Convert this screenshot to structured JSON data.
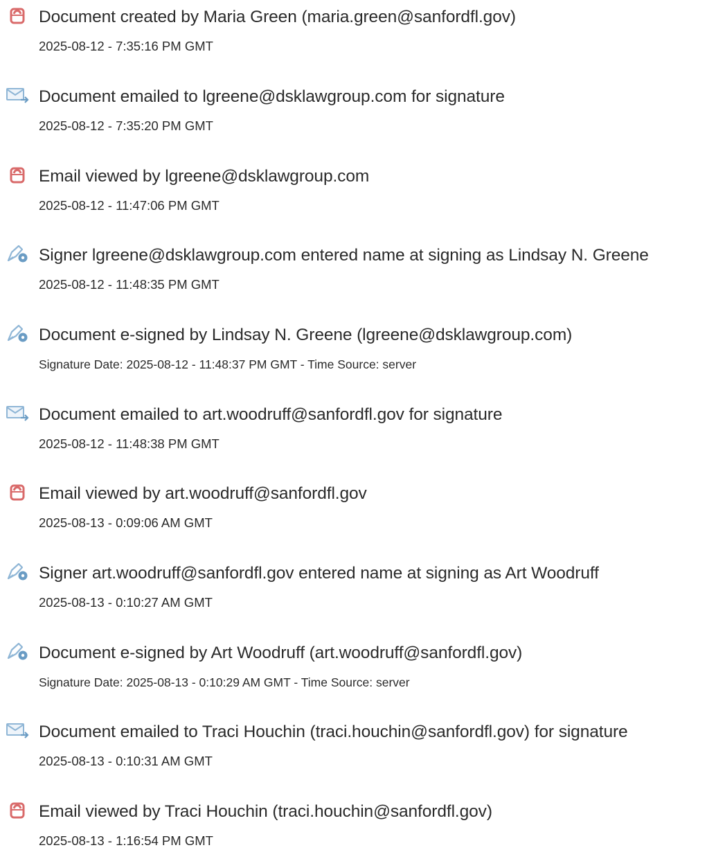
{
  "colors": {
    "pdf_icon": "#d96a6a",
    "email_icon": "#8fb6d6",
    "sign_icon": "#6a9cc4",
    "text": "#2a2a2a"
  },
  "events": [
    {
      "icon": "document-icon",
      "title": "Document created by Maria Green (maria.green@sanfordfl.gov)",
      "timestamp": "2025-08-12 - 7:35:16 PM GMT"
    },
    {
      "icon": "email-sent-icon",
      "title": "Document emailed to lgreene@dsklawgroup.com for signature",
      "timestamp": "2025-08-12 - 7:35:20 PM GMT"
    },
    {
      "icon": "document-icon",
      "title": "Email viewed by lgreene@dsklawgroup.com",
      "timestamp": "2025-08-12 - 11:47:06 PM GMT"
    },
    {
      "icon": "signature-pen-icon",
      "title": "Signer lgreene@dsklawgroup.com entered name at signing as Lindsay N. Greene",
      "timestamp": "2025-08-12 - 11:48:35 PM GMT"
    },
    {
      "icon": "signature-pen-icon",
      "title": "Document e-signed by Lindsay N. Greene (lgreene@dsklawgroup.com)",
      "timestamp": "Signature Date: 2025-08-12 - 11:48:37 PM GMT - Time Source: server"
    },
    {
      "icon": "email-sent-icon",
      "title": "Document emailed to art.woodruff@sanfordfl.gov for signature",
      "timestamp": "2025-08-12 - 11:48:38 PM GMT"
    },
    {
      "icon": "document-icon",
      "title": "Email viewed by art.woodruff@sanfordfl.gov",
      "timestamp": "2025-08-13 - 0:09:06 AM GMT"
    },
    {
      "icon": "signature-pen-icon",
      "title": "Signer art.woodruff@sanfordfl.gov entered name at signing as Art Woodruff",
      "timestamp": "2025-08-13 - 0:10:27 AM GMT"
    },
    {
      "icon": "signature-pen-icon",
      "title": "Document e-signed by Art Woodruff (art.woodruff@sanfordfl.gov)",
      "timestamp": "Signature Date: 2025-08-13 - 0:10:29 AM GMT - Time Source: server"
    },
    {
      "icon": "email-sent-icon",
      "title": "Document emailed to Traci Houchin (traci.houchin@sanfordfl.gov) for signature",
      "timestamp": "2025-08-13 - 0:10:31 AM GMT"
    },
    {
      "icon": "document-icon",
      "title": "Email viewed by Traci Houchin (traci.houchin@sanfordfl.gov)",
      "timestamp": "2025-08-13 - 1:16:54 PM GMT"
    }
  ]
}
